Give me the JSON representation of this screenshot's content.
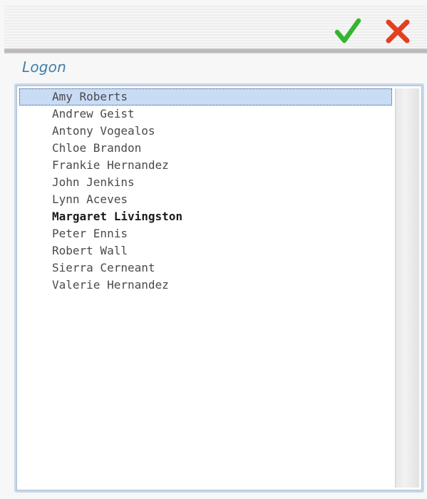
{
  "toolbar": {
    "ok_icon": "checkmark-icon",
    "cancel_icon": "x-icon",
    "ok_color": "#35b52f",
    "cancel_color": "#e2401f"
  },
  "logon": {
    "title": "Logon"
  },
  "users": [
    {
      "name": "Amy Roberts",
      "selected": true,
      "bold": false
    },
    {
      "name": "Andrew Geist",
      "selected": false,
      "bold": false
    },
    {
      "name": "Antony Vogealos",
      "selected": false,
      "bold": false
    },
    {
      "name": "Chloe Brandon",
      "selected": false,
      "bold": false
    },
    {
      "name": "Frankie Hernandez",
      "selected": false,
      "bold": false
    },
    {
      "name": "John Jenkins",
      "selected": false,
      "bold": false
    },
    {
      "name": "Lynn Aceves",
      "selected": false,
      "bold": false
    },
    {
      "name": "Margaret Livingston",
      "selected": false,
      "bold": true
    },
    {
      "name": "Peter Ennis",
      "selected": false,
      "bold": false
    },
    {
      "name": "Robert Wall",
      "selected": false,
      "bold": false
    },
    {
      "name": "Sierra Cerneant",
      "selected": false,
      "bold": false
    },
    {
      "name": "Valerie Hernandez",
      "selected": false,
      "bold": false
    }
  ],
  "colors": {
    "header_text": "#3f7fa8",
    "selection": "#c9dcf6",
    "list_border": "#c7d8e8"
  }
}
